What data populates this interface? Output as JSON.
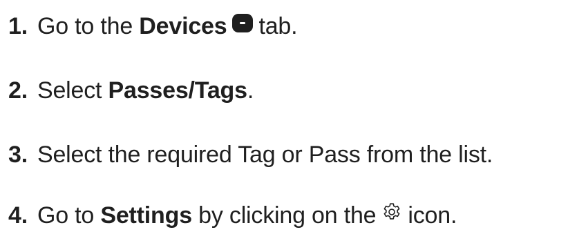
{
  "steps": [
    {
      "number": "1.",
      "text_before": "Go to the ",
      "bold": "Devices",
      "icon": "device-tab-icon",
      "text_after": "tab."
    },
    {
      "number": "2.",
      "text_before": "Select ",
      "bold": "Passes/Tags",
      "text_after": "."
    },
    {
      "number": "3.",
      "text": "Select the required Tag or Pass from the list."
    },
    {
      "number": "4.",
      "text_before": "Go to ",
      "bold": "Settings",
      "text_middle": " by clicking on the",
      "icon": "gear-icon",
      "text_after": "icon."
    }
  ],
  "colors": {
    "text": "#1f1f1f",
    "icon_fill": "#1f1f1f"
  }
}
